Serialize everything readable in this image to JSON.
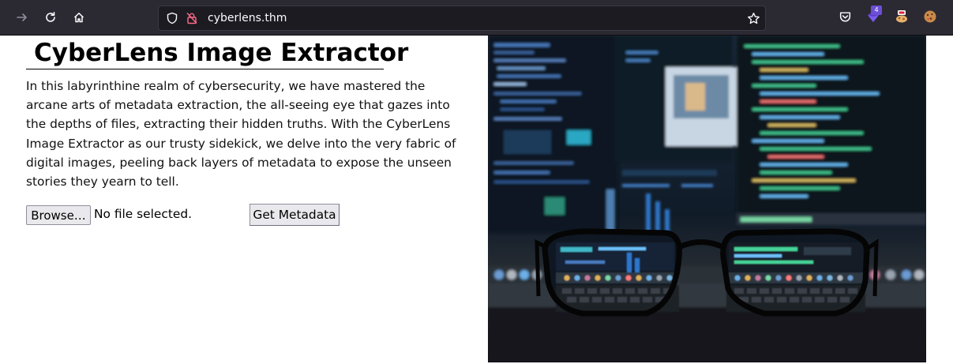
{
  "browser": {
    "url": "cyberlens.thm",
    "extension_badge": "4"
  },
  "page": {
    "title": "CyberLens Image Extractor",
    "intro": "In this labyrinthine realm of cybersecurity, we have mastered the arcane arts of metadata extraction, the all-seeing eye that gazes into the depths of files, extracting their hidden truths. With the CyberLens Image Extractor as our trusty sidekick, we delve into the very fabric of digital images, peeling back layers of metadata to expose the unseen stories they yearn to tell.",
    "browse_label": "Browse…",
    "file_status": "No file selected.",
    "submit_label": "Get Metadata"
  },
  "icons": {
    "back": "arrow-right-icon",
    "reload": "reload-icon",
    "home": "home-icon",
    "shield": "shield-icon",
    "insecure": "lock-slash-icon",
    "bookmark": "star-icon",
    "pocket": "pocket-icon"
  }
}
